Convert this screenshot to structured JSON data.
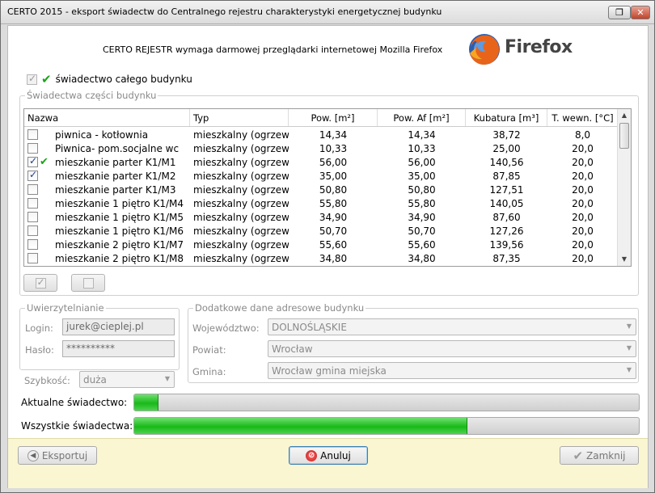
{
  "window": {
    "title": "CERTO 2015 - eksport świadectw do Centralnego rejestru charakterystyki energetycznej budynku"
  },
  "banner": {
    "text": "CERTO REJESTR wymaga darmowej przeglądarki internetowej Mozilla Firefox",
    "logo_word": "Firefox"
  },
  "whole_building": {
    "label": "świadectwo całego budynku",
    "checked": true
  },
  "parts": {
    "title": "Świadectwa części budynku",
    "columns": [
      "Nazwa",
      "Typ",
      "Pow. [m²]",
      "Pow. Af [m²]",
      "Kubatura [m³]",
      "T. wewn. [°C]"
    ],
    "rows": [
      {
        "checked": false,
        "mark": false,
        "name": "piwnica - kotłownia",
        "type": "mieszkalny (ogrzewany)",
        "area": "14,34",
        "area_af": "14,34",
        "volume": "38,72",
        "temp": "8,0"
      },
      {
        "checked": false,
        "mark": false,
        "name": "Piwnica- pom.socjalne wc",
        "type": "mieszkalny (ogrzewany)",
        "area": "10,33",
        "area_af": "10,33",
        "volume": "25,00",
        "temp": "20,0"
      },
      {
        "checked": true,
        "mark": true,
        "name": "mieszkanie parter K1/M1",
        "type": "mieszkalny (ogrzewany)",
        "area": "56,00",
        "area_af": "56,00",
        "volume": "140,56",
        "temp": "20,0"
      },
      {
        "checked": true,
        "mark": false,
        "name": "mieszkanie parter K1/M2",
        "type": "mieszkalny (ogrzewany)",
        "area": "35,00",
        "area_af": "35,00",
        "volume": "87,85",
        "temp": "20,0"
      },
      {
        "checked": false,
        "mark": false,
        "name": "mieszkanie parter K1/M3",
        "type": "mieszkalny (ogrzewany)",
        "area": "50,80",
        "area_af": "50,80",
        "volume": "127,51",
        "temp": "20,0"
      },
      {
        "checked": false,
        "mark": false,
        "name": "mieszkanie 1 piętro K1/M4",
        "type": "mieszkalny (ogrzewany)",
        "area": "55,80",
        "area_af": "55,80",
        "volume": "140,05",
        "temp": "20,0"
      },
      {
        "checked": false,
        "mark": false,
        "name": "mieszkanie 1 piętro K1/M5",
        "type": "mieszkalny (ogrzewany)",
        "area": "34,90",
        "area_af": "34,90",
        "volume": "87,60",
        "temp": "20,0"
      },
      {
        "checked": false,
        "mark": false,
        "name": "mieszkanie 1 piętro K1/M6",
        "type": "mieszkalny (ogrzewany)",
        "area": "50,70",
        "area_af": "50,70",
        "volume": "127,26",
        "temp": "20,0"
      },
      {
        "checked": false,
        "mark": false,
        "name": "mieszkanie 2 piętro  K1/M7",
        "type": "mieszkalny (ogrzewany)",
        "area": "55,60",
        "area_af": "55,60",
        "volume": "139,56",
        "temp": "20,0"
      },
      {
        "checked": false,
        "mark": false,
        "name": "mieszkanie 2 piętro K1/M8",
        "type": "mieszkalny (ogrzewany)",
        "area": "34,80",
        "area_af": "34,80",
        "volume": "87,35",
        "temp": "20,0"
      }
    ]
  },
  "auth": {
    "title": "Uwierzytelnianie",
    "login_label": "Login:",
    "login_value": "jurek@cieplej.pl",
    "password_label": "Hasło:",
    "password_value": "**********"
  },
  "speed": {
    "label": "Szybkość:",
    "value": "duża"
  },
  "address": {
    "title": "Dodatkowe dane adresowe budynku",
    "voivodeship_label": "Województwo:",
    "voivodeship_value": "DOLNOŚLĄSKIE",
    "district_label": "Powiat:",
    "district_value": "Wrocław",
    "commune_label": "Gmina:",
    "commune_value": "Wrocław gmina miejska"
  },
  "progress": {
    "current_label": "Aktualne świadectwo:",
    "current_fraction": 0.048,
    "all_label": "Wszystkie świadectwa:",
    "all_fraction": 0.66
  },
  "footer": {
    "export_label": "Eksportuj",
    "cancel_label": "Anuluj",
    "close_label": "Zamknij"
  },
  "colors": {
    "progress_fill": "#19b919",
    "footer_bg": "#faf6d2",
    "check_green": "#1aa31a"
  }
}
